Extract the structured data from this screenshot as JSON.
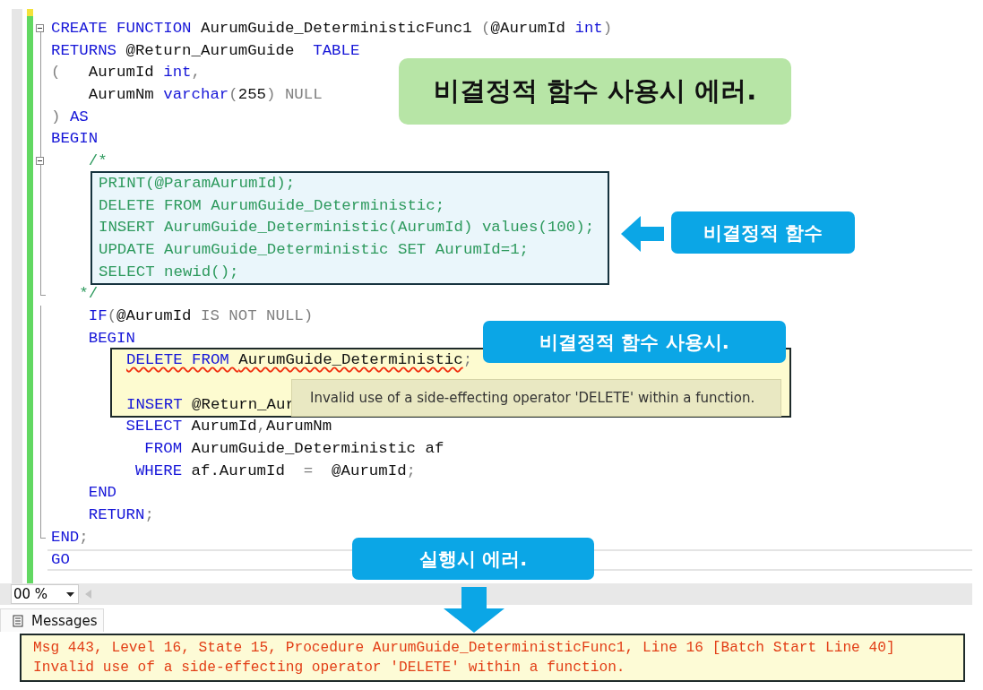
{
  "editor": {
    "blocks": [
      {
        "kind": "plain",
        "lines": [
          {
            "kind": "fold_start",
            "tokens": [
              {
                "text": "CREATE FUNCTION ",
                "kind": "keyword"
              },
              {
                "text": "AurumGuide_DeterministicFunc1 ",
                "kind": "ident"
              },
              {
                "text": "(",
                "kind": "gray"
              },
              {
                "text": "@AurumId ",
                "kind": "ident"
              },
              {
                "text": "int",
                "kind": "keyword"
              },
              {
                "text": ")",
                "kind": "gray"
              }
            ]
          },
          {
            "tokens": [
              {
                "text": "RETURNS ",
                "kind": "keyword"
              },
              {
                "text": "@Return_AurumGuide  ",
                "kind": "ident"
              },
              {
                "text": "TABLE",
                "kind": "keyword"
              }
            ]
          },
          {
            "tokens": [
              {
                "text": "(   ",
                "kind": "gray"
              },
              {
                "text": "AurumId ",
                "kind": "ident"
              },
              {
                "text": "int",
                "kind": "keyword"
              },
              {
                "text": ",",
                "kind": "gray"
              }
            ]
          },
          {
            "tokens": [
              {
                "text": "    AurumNm ",
                "kind": "ident"
              },
              {
                "text": "varchar",
                "kind": "keyword"
              },
              {
                "text": "(",
                "kind": "gray"
              },
              {
                "text": "255",
                "kind": "ident"
              },
              {
                "text": ")",
                "kind": "gray"
              },
              {
                "text": " NULL",
                "kind": "gray"
              }
            ]
          },
          {
            "tokens": [
              {
                "text": ") ",
                "kind": "gray"
              },
              {
                "text": "AS",
                "kind": "keyword"
              }
            ]
          },
          {
            "tokens": [
              {
                "text": "BEGIN",
                "kind": "keyword"
              }
            ]
          },
          {
            "kind": "fold_start",
            "tokens": [
              {
                "text": "    /*",
                "kind": "comment"
              }
            ]
          }
        ]
      },
      {
        "kind": "comment_box",
        "lines": [
          {
            "tokens": [
              {
                "text": "PRINT(@ParamAurumId);",
                "kind": "comment"
              }
            ]
          },
          {
            "tokens": [
              {
                "text": "DELETE FROM AurumGuide_Deterministic;",
                "kind": "comment"
              }
            ]
          },
          {
            "tokens": [
              {
                "text": "INSERT AurumGuide_Deterministic(AurumId) values(100);",
                "kind": "comment"
              }
            ]
          },
          {
            "tokens": [
              {
                "text": "UPDATE AurumGuide_Deterministic SET AurumId=1;",
                "kind": "comment"
              }
            ]
          },
          {
            "tokens": [
              {
                "text": "SELECT newid();",
                "kind": "comment"
              }
            ]
          }
        ]
      },
      {
        "kind": "plain",
        "lines": [
          {
            "kind": "fold_end",
            "tokens": [
              {
                "text": "   */",
                "kind": "comment"
              }
            ]
          },
          {
            "tokens": [
              {
                "text": "    IF",
                "kind": "keyword"
              },
              {
                "text": "(",
                "kind": "gray"
              },
              {
                "text": "@AurumId ",
                "kind": "ident"
              },
              {
                "text": "IS NOT NULL",
                "kind": "gray"
              },
              {
                "text": ")",
                "kind": "gray"
              }
            ]
          },
          {
            "tokens": [
              {
                "text": "    BEGIN",
                "kind": "keyword"
              }
            ]
          }
        ]
      },
      {
        "kind": "error_box",
        "tooltip": "Invalid use of a side-effecting operator 'DELETE' within a function.",
        "lines": [
          {
            "squiggle": true,
            "tokens": [
              {
                "text": "DELETE FROM ",
                "kind": "keyword"
              },
              {
                "text": "AurumGuide_Deterministic",
                "kind": "ident"
              },
              {
                "text": ";",
                "kind": "gray"
              }
            ]
          },
          {
            "kind": "blank"
          },
          {
            "tokens": [
              {
                "text": "INSERT ",
                "kind": "keyword"
              },
              {
                "text": "@Return_Aur",
                "kind": "ident"
              }
            ]
          }
        ]
      },
      {
        "kind": "plain",
        "lines": [
          {
            "tokens": [
              {
                "text": "        SELECT ",
                "kind": "keyword"
              },
              {
                "text": "AurumId",
                "kind": "ident"
              },
              {
                "text": ",",
                "kind": "gray"
              },
              {
                "text": "AurumNm",
                "kind": "ident"
              }
            ]
          },
          {
            "tokens": [
              {
                "text": "          FROM ",
                "kind": "keyword"
              },
              {
                "text": "AurumGuide_Deterministic af",
                "kind": "ident"
              }
            ]
          },
          {
            "tokens": [
              {
                "text": "         WHERE ",
                "kind": "keyword"
              },
              {
                "text": "af.AurumId  ",
                "kind": "ident"
              },
              {
                "text": "=",
                "kind": "gray"
              },
              {
                "text": "  @AurumId",
                "kind": "ident"
              },
              {
                "text": ";",
                "kind": "gray"
              }
            ]
          },
          {
            "tokens": [
              {
                "text": "    END",
                "kind": "keyword"
              }
            ]
          },
          {
            "tokens": [
              {
                "text": "    RETURN",
                "kind": "keyword"
              },
              {
                "text": ";",
                "kind": "gray"
              }
            ]
          },
          {
            "kind": "fold_end",
            "tokens": [
              {
                "text": "END",
                "kind": "keyword"
              },
              {
                "text": ";",
                "kind": "gray"
              }
            ]
          },
          {
            "current": true,
            "tokens": [
              {
                "text": "GO",
                "kind": "keyword"
              }
            ]
          }
        ]
      }
    ]
  },
  "zoom": {
    "value": "00 %"
  },
  "output_tab": {
    "label": "Messages"
  },
  "messages": [
    "Msg 443, Level 16, State 15, Procedure AurumGuide_DeterministicFunc1, Line 16 [Batch Start Line 40]",
    "Invalid use of a side-effecting operator 'DELETE' within a function."
  ],
  "callouts": [
    {
      "kind": "green",
      "text": "비결정적 함수 사용시 에러."
    },
    {
      "kind": "blue_left_arrow",
      "text": "비결정적 함수"
    },
    {
      "kind": "blue",
      "text": "비결정적 함수 사용시."
    },
    {
      "kind": "blue_down_arrow",
      "text": "실행시 에러."
    }
  ]
}
